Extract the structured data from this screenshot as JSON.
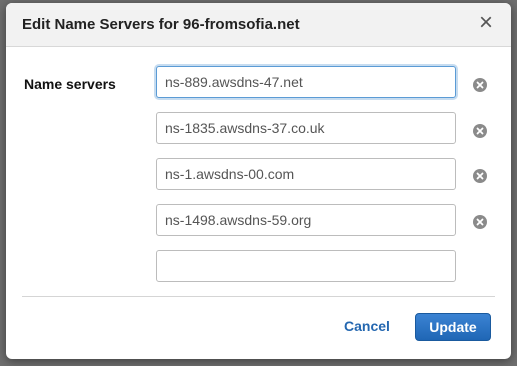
{
  "dialog": {
    "title": "Edit Name Servers for 96-fromsofia.net",
    "close_symbol": "×"
  },
  "form": {
    "label": "Name servers",
    "name_servers": [
      "ns-889.awsdns-47.net",
      "ns-1835.awsdns-37.co.uk",
      "ns-1.awsdns-00.com",
      "ns-1498.awsdns-59.org",
      ""
    ]
  },
  "actions": {
    "cancel_label": "Cancel",
    "update_label": "Update"
  },
  "colors": {
    "primary_button": "#1f66b5",
    "link": "#2467b0",
    "focus_border": "#5b9bd5"
  }
}
